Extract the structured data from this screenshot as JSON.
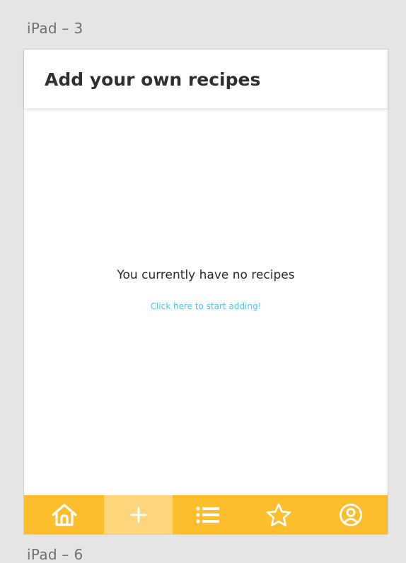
{
  "artboard_labels": {
    "top": "iPad – 3",
    "bottom": "iPad – 6"
  },
  "header": {
    "title": "Add your own recipes"
  },
  "empty_state": {
    "message": "You currently have no recipes",
    "link_text": "Click here to start adding!"
  },
  "tabbar": {
    "tabs": [
      {
        "icon": "home-icon",
        "active": false
      },
      {
        "icon": "plus-icon",
        "active": true
      },
      {
        "icon": "list-icon",
        "active": false
      },
      {
        "icon": "star-icon",
        "active": false
      },
      {
        "icon": "user-circle-icon",
        "active": false
      }
    ]
  },
  "colors": {
    "tabbar_bg": "#fdbe2e",
    "tabbar_active": "#fed67e",
    "link": "#4fc3e8"
  }
}
